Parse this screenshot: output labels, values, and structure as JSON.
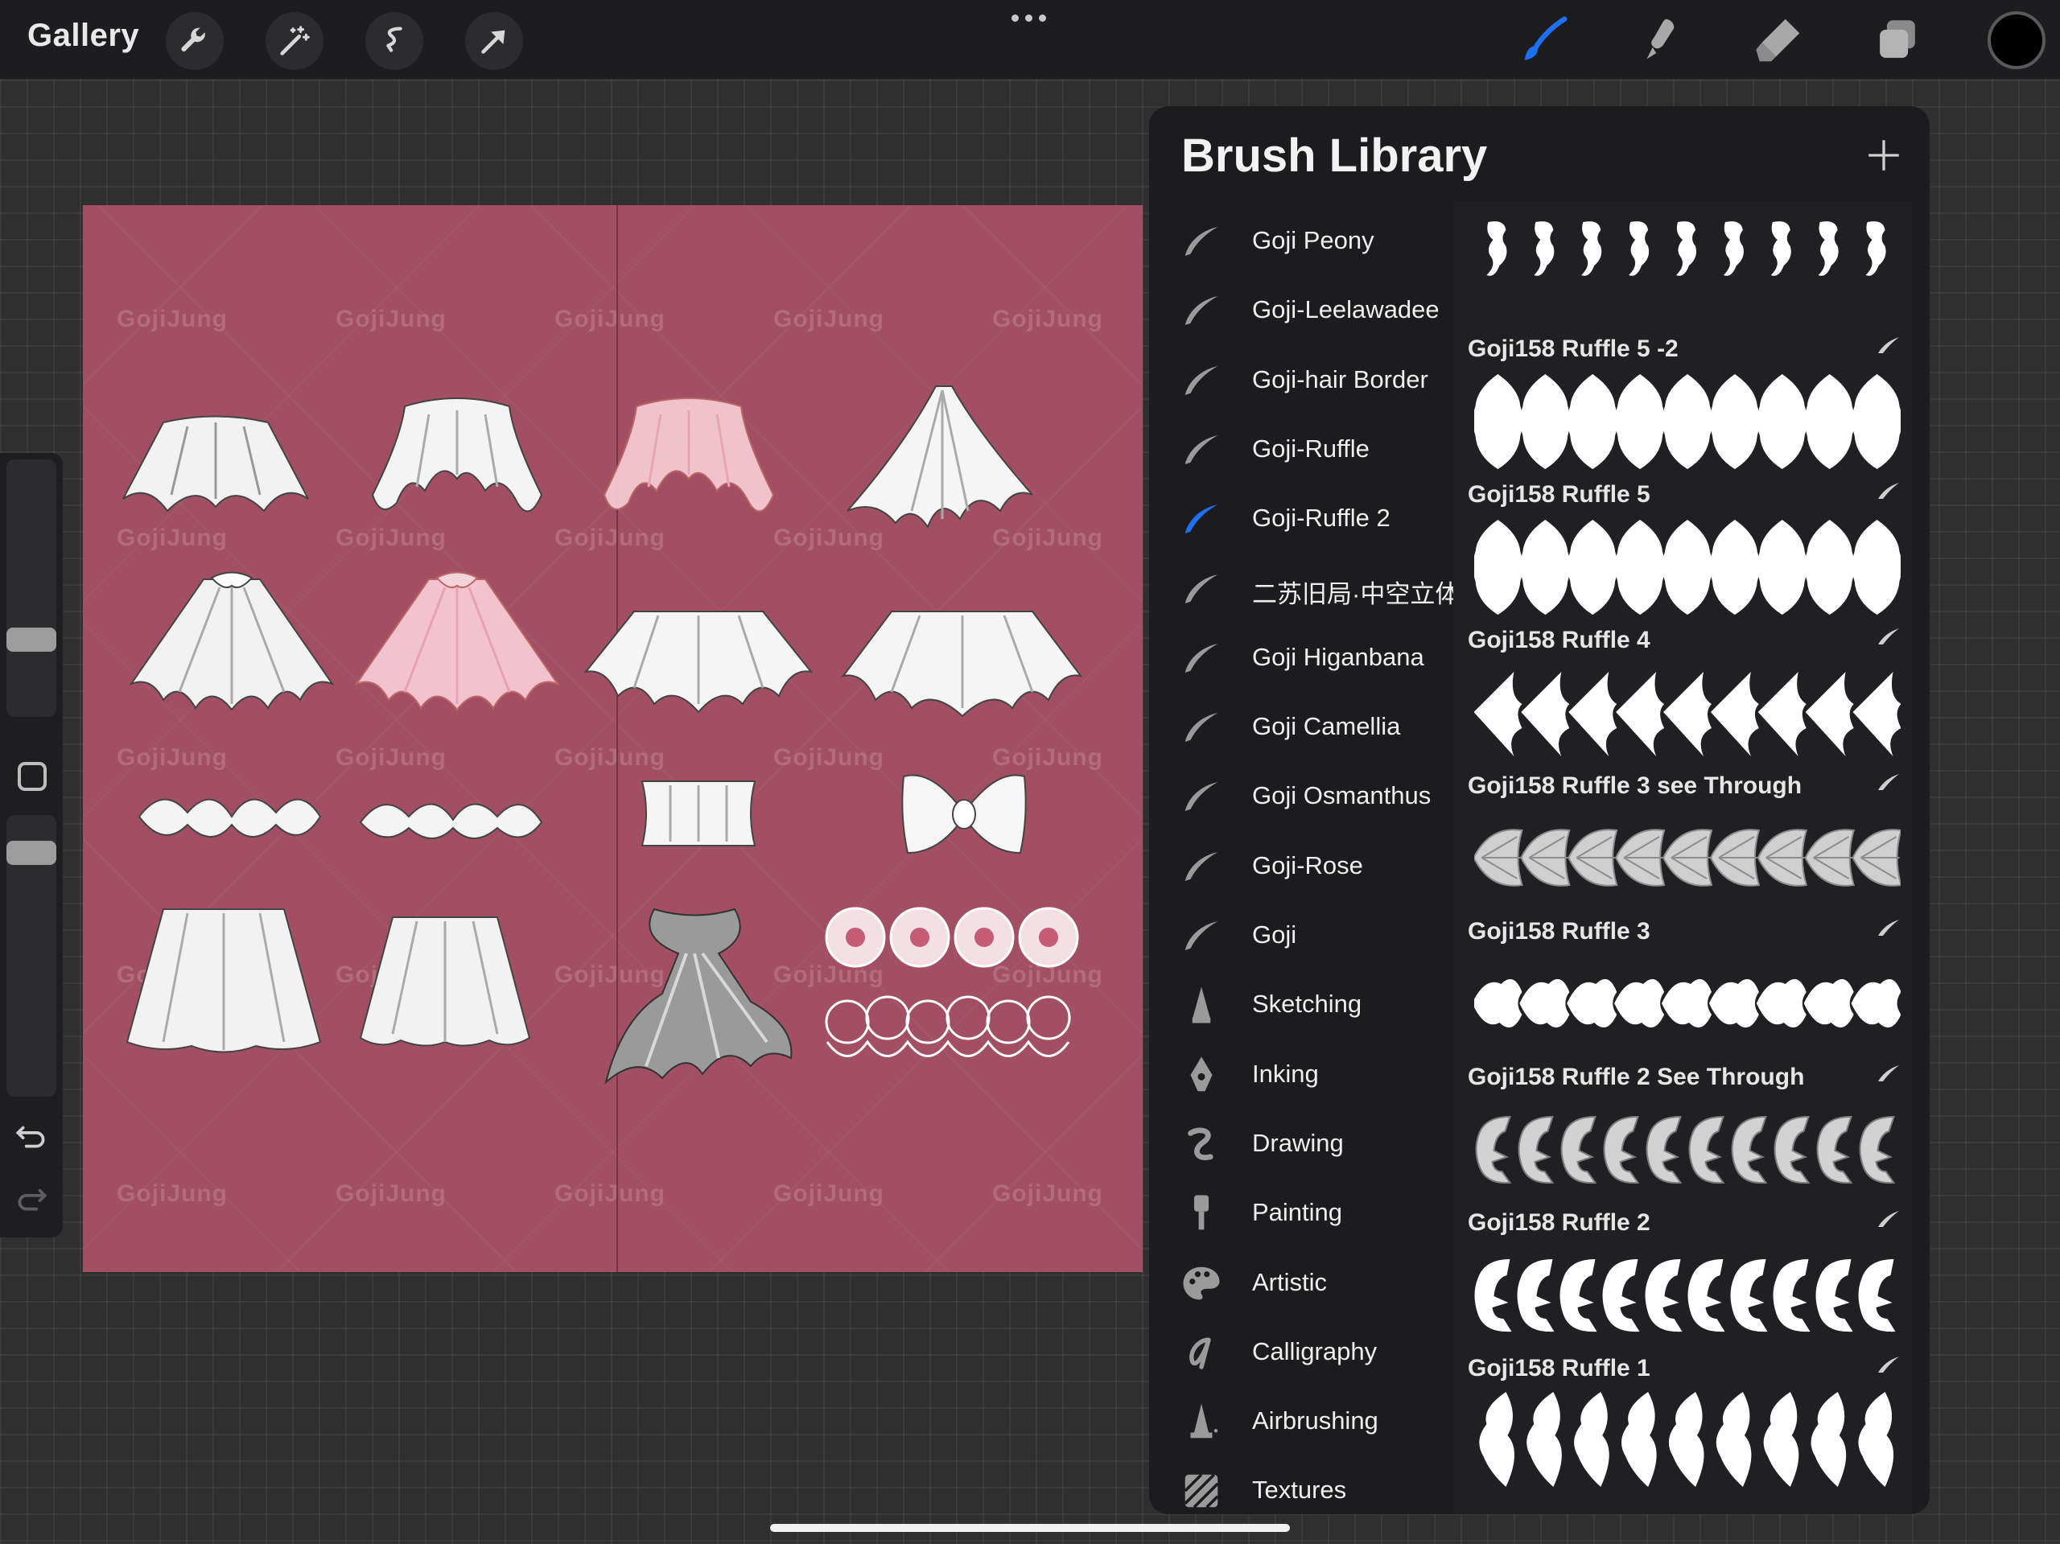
{
  "topbar": {
    "gallery_label": "Gallery",
    "left_tools": [
      "wrench-icon",
      "magic-wand-icon",
      "selection-icon",
      "transform-arrow-icon"
    ],
    "right_tools": [
      "brush-icon",
      "smudge-icon",
      "eraser-icon",
      "layers-icon"
    ],
    "active_tool": "brush",
    "color_well": "#000000"
  },
  "canvas": {
    "background": "#a24f63",
    "watermark": "GojiJung"
  },
  "library": {
    "title": "Brush Library",
    "selected_set": "Goji-Ruffle 2",
    "accent_color": "#1f6ff2",
    "sets": [
      {
        "label": "Goji Peony",
        "icon": "brush-stroke-icon"
      },
      {
        "label": "Goji-Leelawadee",
        "icon": "brush-stroke-icon"
      },
      {
        "label": "Goji-hair Border",
        "icon": "brush-stroke-icon"
      },
      {
        "label": "Goji-Ruffle",
        "icon": "brush-stroke-icon"
      },
      {
        "label": "Goji-Ruffle 2",
        "icon": "brush-stroke-icon"
      },
      {
        "label": "二苏旧局·中空立体",
        "icon": "brush-stroke-icon"
      },
      {
        "label": "Goji Higanbana",
        "icon": "brush-stroke-icon"
      },
      {
        "label": "Goji Camellia",
        "icon": "brush-stroke-icon"
      },
      {
        "label": "Goji Osmanthus",
        "icon": "brush-stroke-icon"
      },
      {
        "label": "Goji-Rose",
        "icon": "brush-stroke-icon"
      },
      {
        "label": "Goji",
        "icon": "brush-stroke-icon"
      },
      {
        "label": "Sketching",
        "icon": "pencil-tip-icon"
      },
      {
        "label": "Inking",
        "icon": "pen-nib-icon"
      },
      {
        "label": "Drawing",
        "icon": "squiggle-icon"
      },
      {
        "label": "Painting",
        "icon": "paint-brush-icon"
      },
      {
        "label": "Artistic",
        "icon": "palette-icon"
      },
      {
        "label": "Calligraphy",
        "icon": "calligraphy-icon"
      },
      {
        "label": "Airbrushing",
        "icon": "airbrush-icon"
      },
      {
        "label": "Textures",
        "icon": "texture-icon"
      }
    ],
    "brushes": [
      {
        "name": "",
        "style": "peony"
      },
      {
        "name": "Goji158 Ruffle 5 -2",
        "style": "solid"
      },
      {
        "name": "Goji158 Ruffle 5",
        "style": "solid"
      },
      {
        "name": "Goji158 Ruffle 4",
        "style": "arrow"
      },
      {
        "name": "Goji158 Ruffle 3 see Through",
        "style": "grey"
      },
      {
        "name": "Goji158 Ruffle 3",
        "style": "wave"
      },
      {
        "name": "Goji158 Ruffle 2 See Through",
        "style": "greyE"
      },
      {
        "name": "Goji158 Ruffle 2",
        "style": "E"
      },
      {
        "name": "Goji158 Ruffle 1",
        "style": "leaf"
      }
    ]
  }
}
